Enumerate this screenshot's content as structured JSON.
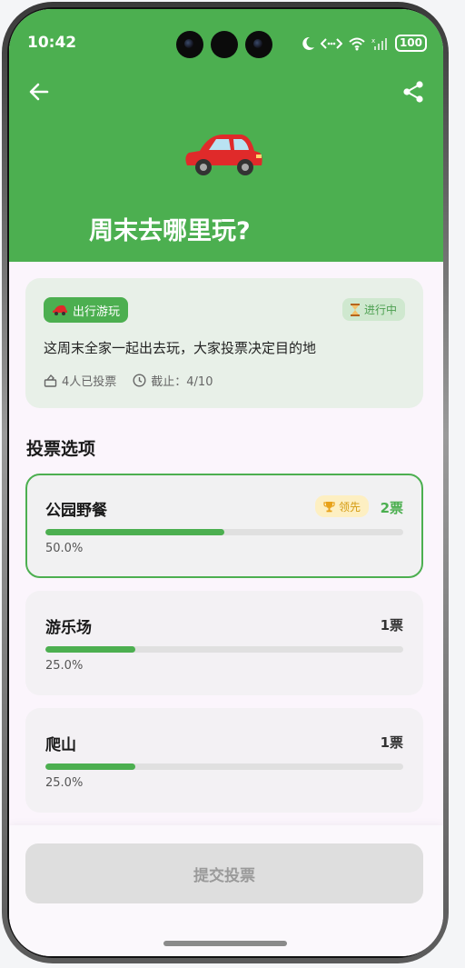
{
  "status_bar": {
    "time": "10:42",
    "battery": "100"
  },
  "header": {
    "title": "周末去哪里玩?",
    "emoji": "🚗"
  },
  "info": {
    "category": "出行游玩",
    "status": "进行中",
    "description": "这周末全家一起出去玩，大家投票决定目的地",
    "voters": "4人已投票",
    "deadline": "截止：4/10"
  },
  "section_title": "投票选项",
  "options": [
    {
      "name": "公园野餐",
      "votes": "2票",
      "percent": "50.0%",
      "fill": 0.5,
      "badge": "领先"
    },
    {
      "name": "游乐场",
      "votes": "1票",
      "percent": "25.0%",
      "fill": 0.25
    },
    {
      "name": "爬山",
      "votes": "1票",
      "percent": "25.0%",
      "fill": 0.25
    }
  ],
  "submit_label": "提交投票",
  "colors": {
    "primary": "#4caf50",
    "badge_bg": "#fdefc2",
    "badge_text": "#d49a10"
  }
}
